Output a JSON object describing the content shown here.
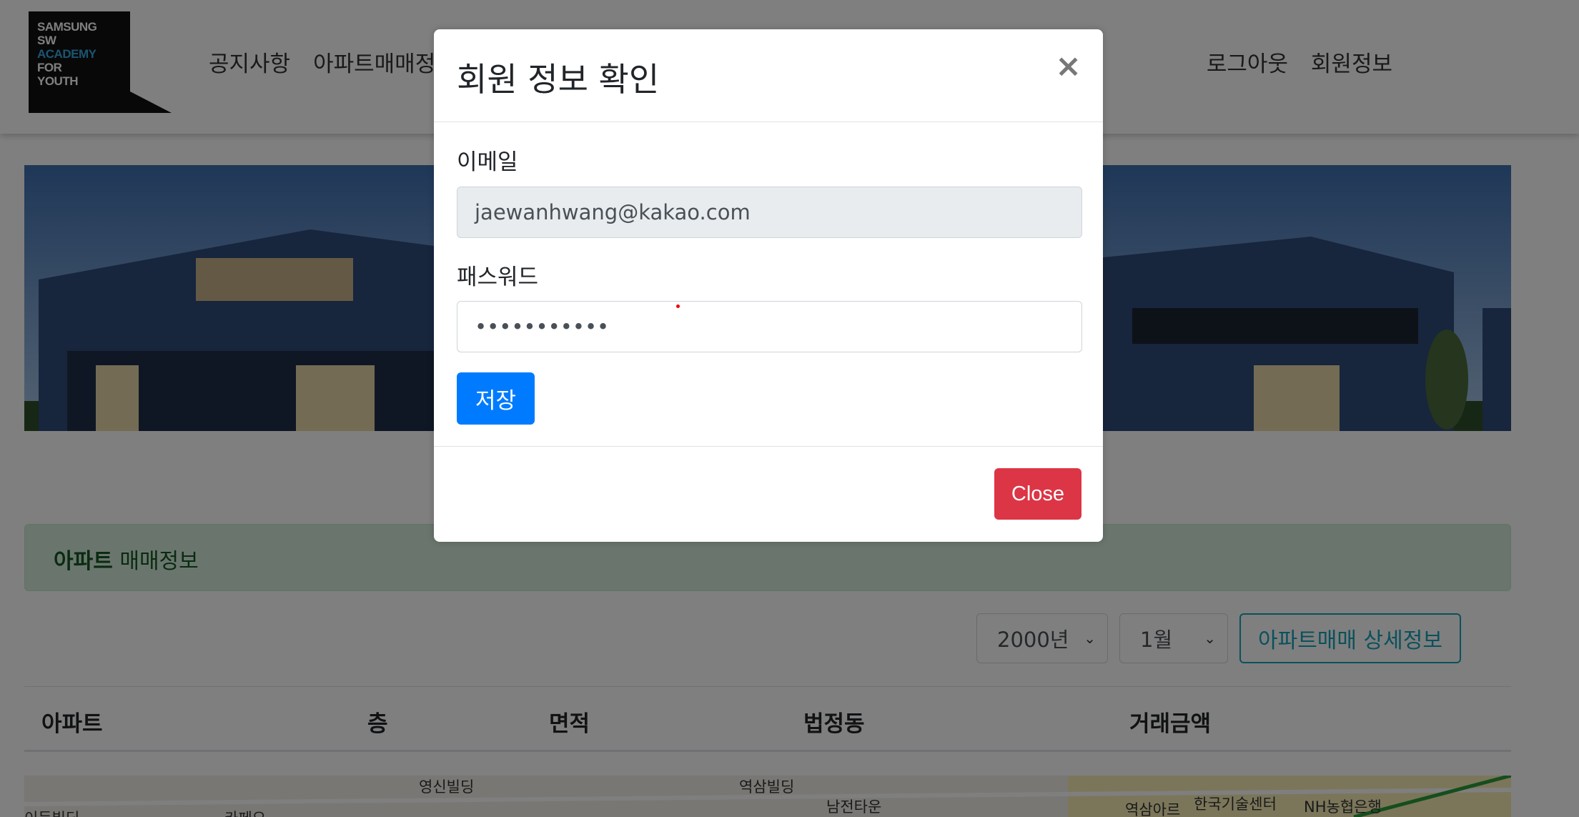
{
  "logo": {
    "lines": [
      "SAMSUNG",
      "SW",
      "ACADEMY",
      "FOR",
      "YOUTH"
    ]
  },
  "nav": {
    "left_items": [
      "공지사항",
      "아파트매매정"
    ],
    "right_items": [
      "로그아웃",
      "회원정보"
    ]
  },
  "alert": {
    "bold": "아파트",
    "text": " 매매정보"
  },
  "filters": {
    "year": "2000년",
    "month": "1월",
    "detail_button": "아파트매매 상세정보"
  },
  "table": {
    "headers": [
      "아파트",
      "층",
      "면적",
      "법정동",
      "거래금액"
    ]
  },
  "map": {
    "labels": [
      "영신빌딩",
      "역삼빌딩",
      "남전타운",
      "역삼아르",
      "한국기술센터",
      "NH농협은행",
      "이든빌딩",
      "카페오"
    ]
  },
  "modal": {
    "title": "회원 정보 확인",
    "close_icon": "×",
    "email_label": "이메일",
    "email_value": "jaewanhwang@kakao.com",
    "password_label": "패스워드",
    "password_value": "•••••••••••",
    "save_button": "저장",
    "close_button": "Close"
  },
  "colors": {
    "primary": "#007bff",
    "danger": "#dc3545",
    "info": "#17a2b8",
    "alert_bg": "#d4edda",
    "alert_text": "#155724"
  }
}
